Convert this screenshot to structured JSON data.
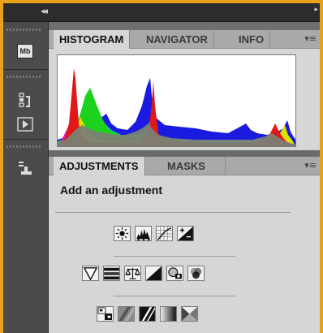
{
  "topbar": {
    "collapse_glyph": "◂◂",
    "expand_glyph": "▸"
  },
  "dock": {
    "items": [
      {
        "icon": "mini-bridge-icon",
        "label": "Mb"
      },
      {
        "icon": "history-icon"
      },
      {
        "icon": "actions-play-icon"
      },
      {
        "icon": "clone-source-icon"
      }
    ]
  },
  "histogram_panel": {
    "tabs": [
      {
        "label": "HISTOGRAM",
        "active": true
      },
      {
        "label": "NAVIGATOR",
        "active": false
      },
      {
        "label": "INFO",
        "active": false
      }
    ],
    "menu_glyph": "▾≡"
  },
  "adjustments_panel": {
    "tabs": [
      {
        "label": "ADJUSTMENTS",
        "active": true
      },
      {
        "label": "MASKS",
        "active": false
      }
    ],
    "title": "Add an adjustment",
    "menu_glyph": "▾≡",
    "rows": [
      [
        "brightness-contrast-icon",
        "levels-icon",
        "curves-icon",
        "exposure-icon"
      ],
      [
        "vibrance-icon",
        "hue-saturation-icon",
        "color-balance-icon",
        "black-white-icon",
        "photo-filter-icon",
        "channel-mixer-icon"
      ],
      [
        "invert-icon",
        "posterize-icon",
        "threshold-icon",
        "gradient-map-icon",
        "selective-color-icon"
      ]
    ]
  },
  "colors": {
    "accent_border": "#e8a21a",
    "panel_bg": "#d6d6d6",
    "dock_bg": "#4b4b4b"
  }
}
